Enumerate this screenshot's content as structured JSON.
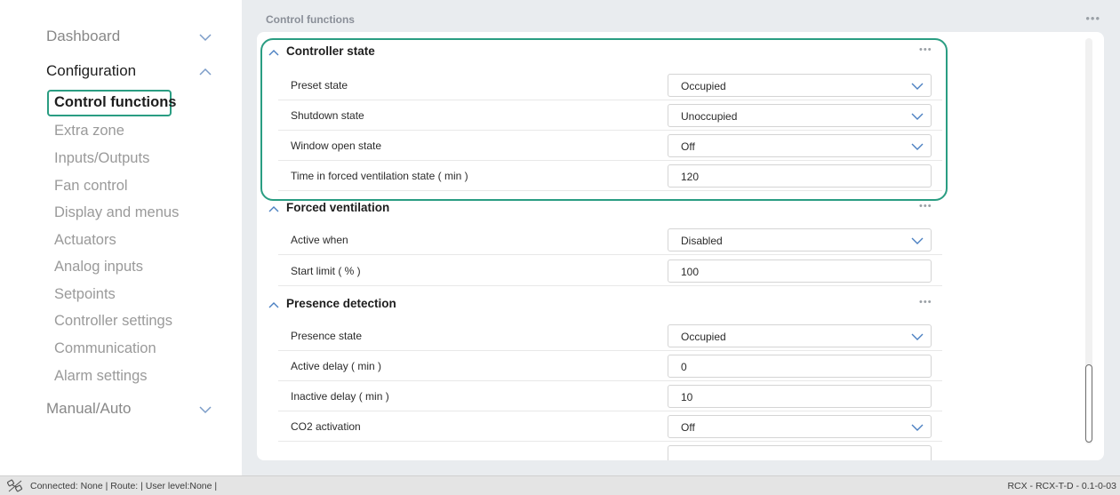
{
  "sidebar": {
    "dashboard": "Dashboard",
    "configuration": "Configuration",
    "manual_auto": "Manual/Auto",
    "items": [
      "Control functions",
      "Extra zone",
      "Inputs/Outputs",
      "Fan control",
      "Display and menus",
      "Actuators",
      "Analog inputs",
      "Setpoints",
      "Controller settings",
      "Communication",
      "Alarm settings"
    ]
  },
  "main": {
    "title": "Control functions",
    "more": "•••"
  },
  "sections": [
    {
      "title": "Controller state",
      "more": "•••",
      "rows": [
        {
          "label": "Preset state",
          "value": "Occupied",
          "type": "select"
        },
        {
          "label": "Shutdown state",
          "value": "Unoccupied",
          "type": "select"
        },
        {
          "label": "Window open state",
          "value": "Off",
          "type": "select"
        },
        {
          "label": "Time in forced ventilation state ( min )",
          "value": "120",
          "type": "input"
        }
      ]
    },
    {
      "title": "Forced ventilation",
      "more": "•••",
      "rows": [
        {
          "label": "Active when",
          "value": "Disabled",
          "type": "select"
        },
        {
          "label": "Start limit ( % )",
          "value": "100",
          "type": "input"
        }
      ]
    },
    {
      "title": "Presence detection",
      "more": "•••",
      "rows": [
        {
          "label": "Presence state",
          "value": "Occupied",
          "type": "select"
        },
        {
          "label": "Active delay ( min )",
          "value": "0",
          "type": "input"
        },
        {
          "label": "Inactive delay ( min )",
          "value": "10",
          "type": "input"
        },
        {
          "label": "CO2 activation",
          "value": "Off",
          "type": "select"
        }
      ]
    }
  ],
  "statusbar": {
    "left": "Connected: None | Route: | User level:None |",
    "right": "RCX - RCX-T-D - 0.1-0-03"
  },
  "colors": {
    "accent": "#2a9d82",
    "chevron": "#4a7fc1"
  }
}
